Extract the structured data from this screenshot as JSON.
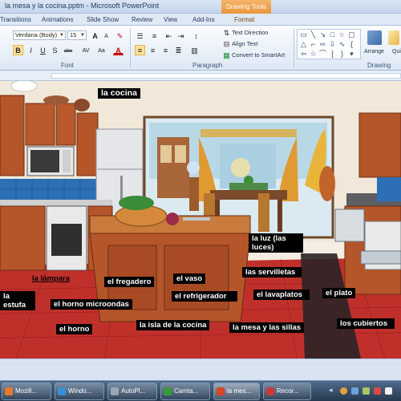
{
  "window": {
    "title": "la mesa y la cocina.pptm - Microsoft PowerPoint",
    "contextual_tab": "Drawing Tools"
  },
  "tabs": [
    {
      "label": "Transitions"
    },
    {
      "label": "Animations"
    },
    {
      "label": "Slide Show"
    },
    {
      "label": "Review"
    },
    {
      "label": "View"
    },
    {
      "label": "Add-Ins"
    },
    {
      "label": "Format"
    }
  ],
  "ribbon": {
    "font_name": "Verdana (Body)",
    "font_size": "15",
    "group_font": "Font",
    "group_paragraph": "Paragraph",
    "group_drawing": "Drawing",
    "text_direction": "Text Direction",
    "align_text": "Align Text",
    "convert_smartart": "Convert to SmartArt",
    "arrange": "Arrange",
    "quick_styles": "Quick Styles",
    "bold": "B",
    "italic": "I",
    "underline": "U",
    "strike": "S",
    "shadow": "abc",
    "font_color": "A"
  },
  "slide": {
    "labels": {
      "title": "la cocina",
      "luz": "la luz (las luces)",
      "lampara": "la lámpara",
      "fregadero": "el fregadero",
      "vaso": "el vaso",
      "servilletas": "las servilletas",
      "estufa": "la estufa",
      "microondas": "el horno microondas",
      "refrigerador": "el refrigerador",
      "lavaplatos": "el lavaplatos",
      "plato": "el plato",
      "horno": "el horno",
      "isla": "la isla de la cocina",
      "mesa_sillas": "la mesa  y  las sillas",
      "cubiertos": "los cubiertos"
    }
  },
  "taskbar": {
    "items": [
      {
        "label": "Mozill..."
      },
      {
        "label": "Windo..."
      },
      {
        "label": "AutoPl..."
      },
      {
        "label": "Camta..."
      },
      {
        "label": "la mes..."
      },
      {
        "label": "Recor..."
      }
    ]
  },
  "colors": {
    "label_bg": "#000000",
    "label_fg": "#ffffff",
    "cabinet": "#b5552a",
    "floor": "#c02a2a",
    "ribbon_accent": "#fde19a"
  }
}
